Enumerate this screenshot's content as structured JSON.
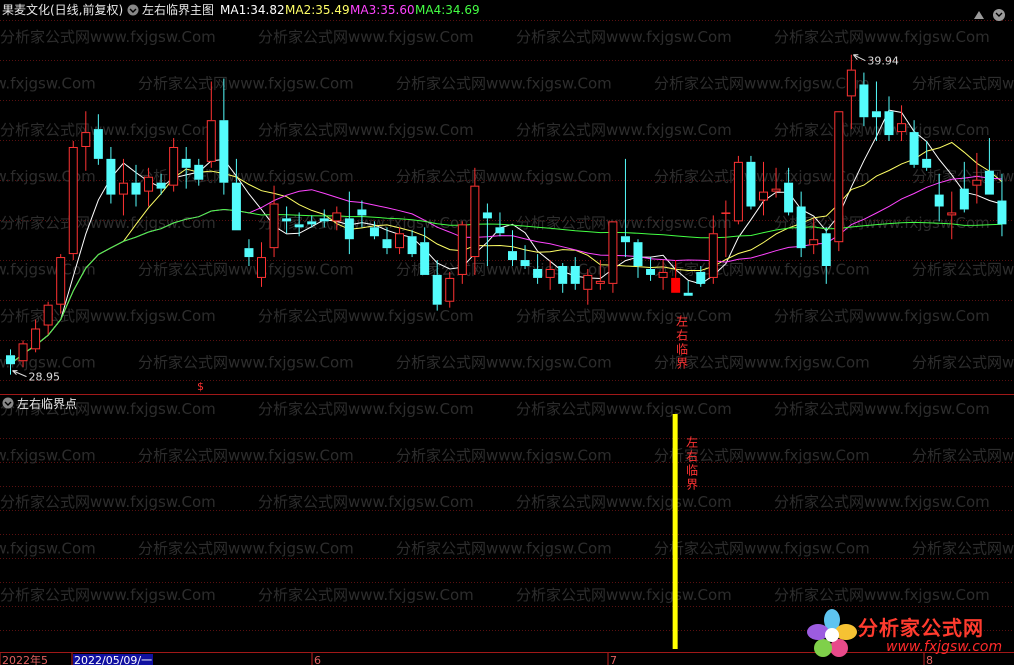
{
  "header": {
    "stock_title": "果麦文化(日线,前复权)",
    "indicator_title": "左右临界主图",
    "ma": [
      {
        "label": "MA1:",
        "value": "34.82",
        "color": "#ffffff"
      },
      {
        "label": "MA2:",
        "value": "35.49",
        "color": "#ffff66"
      },
      {
        "label": "MA3:",
        "value": "35.60",
        "color": "#ff44ff"
      },
      {
        "label": "MA4:",
        "value": "34.69",
        "color": "#44ff44"
      }
    ]
  },
  "sub": {
    "title": "左右临界点",
    "signal_label": "左右临界"
  },
  "main_signal_label": "左右临界",
  "dollar_mark": "$",
  "high_label": "39.94",
  "low_label": "28.95",
  "x_axis": [
    {
      "label": "2022年5",
      "highlight": false
    },
    {
      "label": "2022/05/09/一",
      "highlight": true
    },
    {
      "label": "6",
      "highlight": false
    },
    {
      "label": "7",
      "highlight": false
    },
    {
      "label": "8",
      "highlight": false
    }
  ],
  "watermark": "分析家公式网www.fxjgsw.Com",
  "logo": {
    "brand": "分析家公式网",
    "url": "www.fxjgsw.com"
  },
  "colors": {
    "up": "#ff3333",
    "down": "#54fcfc",
    "signal_up": "#ff0000",
    "signal_bar": "#ffff00"
  },
  "chart_data": {
    "type": "candlestick",
    "y_range": [
      28.5,
      40.8
    ],
    "candles": [
      {
        "o": 29.6,
        "h": 29.8,
        "l": 28.95,
        "c": 29.3
      },
      {
        "o": 29.4,
        "h": 30.1,
        "l": 29.2,
        "c": 30.0
      },
      {
        "o": 29.8,
        "h": 30.8,
        "l": 29.7,
        "c": 30.5
      },
      {
        "o": 30.6,
        "h": 31.4,
        "l": 30.3,
        "c": 31.3
      },
      {
        "o": 31.3,
        "h": 33.0,
        "l": 31.0,
        "c": 32.9
      },
      {
        "o": 33.0,
        "h": 36.8,
        "l": 32.8,
        "c": 36.6
      },
      {
        "o": 36.6,
        "h": 37.8,
        "l": 35.8,
        "c": 37.1
      },
      {
        "o": 37.2,
        "h": 37.7,
        "l": 36.0,
        "c": 36.2
      },
      {
        "o": 36.2,
        "h": 36.6,
        "l": 34.7,
        "c": 35.0
      },
      {
        "o": 35.0,
        "h": 36.2,
        "l": 34.3,
        "c": 35.4
      },
      {
        "o": 35.4,
        "h": 36.0,
        "l": 34.6,
        "c": 35.0
      },
      {
        "o": 35.1,
        "h": 35.9,
        "l": 34.6,
        "c": 35.6
      },
      {
        "o": 35.4,
        "h": 35.7,
        "l": 35.0,
        "c": 35.2
      },
      {
        "o": 35.3,
        "h": 36.9,
        "l": 35.1,
        "c": 36.6
      },
      {
        "o": 36.2,
        "h": 36.6,
        "l": 35.2,
        "c": 35.9
      },
      {
        "o": 36.0,
        "h": 36.2,
        "l": 35.3,
        "c": 35.5
      },
      {
        "o": 36.1,
        "h": 38.8,
        "l": 35.9,
        "c": 37.5
      },
      {
        "o": 37.5,
        "h": 38.9,
        "l": 35.0,
        "c": 35.4
      },
      {
        "o": 35.4,
        "h": 36.2,
        "l": 33.8,
        "c": 33.8
      },
      {
        "o": 33.2,
        "h": 33.5,
        "l": 32.6,
        "c": 32.9
      },
      {
        "o": 32.2,
        "h": 33.4,
        "l": 31.9,
        "c": 32.9
      },
      {
        "o": 33.2,
        "h": 35.3,
        "l": 32.9,
        "c": 34.7
      },
      {
        "o": 34.2,
        "h": 34.6,
        "l": 33.7,
        "c": 34.1
      },
      {
        "o": 34.0,
        "h": 34.4,
        "l": 33.6,
        "c": 33.9
      },
      {
        "o": 34.1,
        "h": 34.3,
        "l": 33.9,
        "c": 34.0
      },
      {
        "o": 34.2,
        "h": 34.5,
        "l": 33.9,
        "c": 34.1
      },
      {
        "o": 34.1,
        "h": 34.6,
        "l": 33.8,
        "c": 34.4
      },
      {
        "o": 34.2,
        "h": 35.1,
        "l": 33.0,
        "c": 33.5
      },
      {
        "o": 34.5,
        "h": 34.8,
        "l": 33.9,
        "c": 34.3
      },
      {
        "o": 33.9,
        "h": 34.1,
        "l": 33.5,
        "c": 33.6
      },
      {
        "o": 33.5,
        "h": 33.9,
        "l": 33.0,
        "c": 33.2
      },
      {
        "o": 33.2,
        "h": 33.9,
        "l": 33.0,
        "c": 33.7
      },
      {
        "o": 33.6,
        "h": 33.8,
        "l": 32.9,
        "c": 33.0
      },
      {
        "o": 33.4,
        "h": 33.9,
        "l": 32.3,
        "c": 32.3
      },
      {
        "o": 32.3,
        "h": 32.8,
        "l": 31.1,
        "c": 31.3
      },
      {
        "o": 31.4,
        "h": 32.4,
        "l": 31.2,
        "c": 32.2
      },
      {
        "o": 32.3,
        "h": 34.1,
        "l": 32.0,
        "c": 34.0
      },
      {
        "o": 32.9,
        "h": 35.9,
        "l": 32.3,
        "c": 35.3
      },
      {
        "o": 34.4,
        "h": 34.7,
        "l": 32.6,
        "c": 34.2
      },
      {
        "o": 33.9,
        "h": 34.4,
        "l": 33.6,
        "c": 33.7
      },
      {
        "o": 33.1,
        "h": 33.8,
        "l": 32.6,
        "c": 32.8
      },
      {
        "o": 32.8,
        "h": 33.3,
        "l": 32.5,
        "c": 32.6
      },
      {
        "o": 32.5,
        "h": 33.0,
        "l": 32.0,
        "c": 32.2
      },
      {
        "o": 32.2,
        "h": 32.8,
        "l": 31.8,
        "c": 32.5
      },
      {
        "o": 32.6,
        "h": 32.7,
        "l": 31.7,
        "c": 32.0
      },
      {
        "o": 32.6,
        "h": 32.9,
        "l": 31.8,
        "c": 32.0
      },
      {
        "o": 31.8,
        "h": 32.5,
        "l": 31.3,
        "c": 32.3
      },
      {
        "o": 32.0,
        "h": 32.8,
        "l": 31.8,
        "c": 32.1
      },
      {
        "o": 32.0,
        "h": 34.1,
        "l": 31.7,
        "c": 34.1
      },
      {
        "o": 33.6,
        "h": 36.2,
        "l": 32.9,
        "c": 33.4
      },
      {
        "o": 33.4,
        "h": 33.5,
        "l": 32.2,
        "c": 32.6
      },
      {
        "o": 32.5,
        "h": 32.9,
        "l": 32.1,
        "c": 32.3
      },
      {
        "o": 32.2,
        "h": 32.8,
        "l": 31.8,
        "c": 32.4
      },
      {
        "o": 32.2,
        "h": 32.8,
        "l": 31.7,
        "c": 31.7
      },
      {
        "o": 31.7,
        "h": 32.1,
        "l": 31.6,
        "c": 31.6
      },
      {
        "o": 32.4,
        "h": 32.6,
        "l": 31.9,
        "c": 32.0
      },
      {
        "o": 32.2,
        "h": 34.3,
        "l": 32.0,
        "c": 33.7
      },
      {
        "o": 34.4,
        "h": 34.8,
        "l": 32.9,
        "c": 34.4
      },
      {
        "o": 34.1,
        "h": 36.3,
        "l": 34.0,
        "c": 36.1
      },
      {
        "o": 36.1,
        "h": 36.3,
        "l": 34.5,
        "c": 34.6
      },
      {
        "o": 34.8,
        "h": 36.1,
        "l": 34.3,
        "c": 35.1
      },
      {
        "o": 35.1,
        "h": 35.9,
        "l": 34.9,
        "c": 35.2
      },
      {
        "o": 35.4,
        "h": 35.9,
        "l": 34.3,
        "c": 34.4
      },
      {
        "o": 34.6,
        "h": 35.1,
        "l": 32.9,
        "c": 33.2
      },
      {
        "o": 33.3,
        "h": 34.2,
        "l": 33.0,
        "c": 33.5
      },
      {
        "o": 33.7,
        "h": 33.9,
        "l": 32.0,
        "c": 32.6
      },
      {
        "o": 33.4,
        "h": 37.8,
        "l": 33.1,
        "c": 37.8
      },
      {
        "o": 38.3,
        "h": 39.7,
        "l": 37.2,
        "c": 39.2
      },
      {
        "o": 38.7,
        "h": 39.1,
        "l": 37.3,
        "c": 37.6
      },
      {
        "o": 37.8,
        "h": 38.8,
        "l": 36.8,
        "c": 37.6
      },
      {
        "o": 37.8,
        "h": 38.3,
        "l": 36.8,
        "c": 37.0
      },
      {
        "o": 37.1,
        "h": 38.0,
        "l": 36.8,
        "c": 37.4
      },
      {
        "o": 37.1,
        "h": 37.5,
        "l": 35.9,
        "c": 36.0
      },
      {
        "o": 36.2,
        "h": 36.8,
        "l": 35.8,
        "c": 35.9
      },
      {
        "o": 35.0,
        "h": 35.7,
        "l": 34.1,
        "c": 34.6
      },
      {
        "o": 34.3,
        "h": 35.1,
        "l": 33.5,
        "c": 34.4
      },
      {
        "o": 35.2,
        "h": 36.1,
        "l": 34.4,
        "c": 34.5
      },
      {
        "o": 35.3,
        "h": 36.4,
        "l": 34.7,
        "c": 35.5
      },
      {
        "o": 35.8,
        "h": 36.9,
        "l": 35.0,
        "c": 35.0
      },
      {
        "o": 34.8,
        "h": 35.7,
        "l": 33.6,
        "c": 34.0
      }
    ],
    "signal_index": 53,
    "ma_series": [
      {
        "name": "MA1",
        "color": "#ffffff",
        "period": 5
      },
      {
        "name": "MA2",
        "color": "#ffff66",
        "period": 10
      },
      {
        "name": "MA3",
        "color": "#ff44ff",
        "period": 20
      },
      {
        "name": "MA4",
        "color": "#44ff44",
        "period": 60
      }
    ]
  }
}
